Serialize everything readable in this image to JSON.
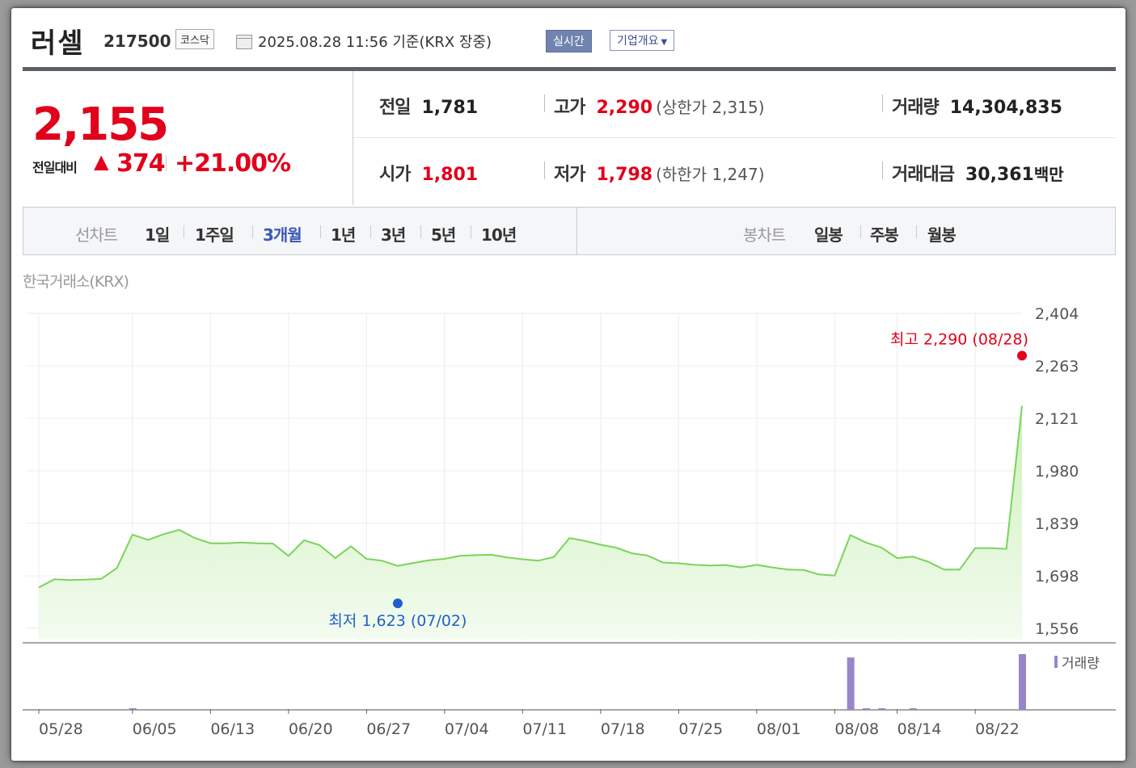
{
  "header": {
    "name": "러셀",
    "code": "217500",
    "market": "코스닥",
    "timestamp": "2025.08.28 11:56 기준(KRX 장중)",
    "realtime_label": "실시간",
    "company_label": "기업개요"
  },
  "price": {
    "current": "2,155",
    "change_label": "전일대비",
    "change_value": "374",
    "change_pct": "+21.00%"
  },
  "stats": {
    "prev_label": "전일",
    "prev": "1,781",
    "open_label": "시가",
    "open": "1,801",
    "high_label": "고가",
    "high": "2,290",
    "upper_label": "상한가",
    "upper": "2,315",
    "low_label": "저가",
    "low": "1,798",
    "lower_label": "하한가",
    "lower": "1,247",
    "volume_label": "거래량",
    "volume": "14,304,835",
    "amount_label": "거래대금",
    "amount": "30,361",
    "amount_unit": "백만"
  },
  "tabs": {
    "line_label": "선차트",
    "line_periods": [
      "1일",
      "1주일",
      "3개월",
      "1년",
      "3년",
      "5년",
      "10년"
    ],
    "active_period": "3개월",
    "candle_label": "봉차트",
    "candle_periods": [
      "일봉",
      "주봉",
      "월봉"
    ]
  },
  "exchange_label": "한국거래소(KRX)",
  "colors": {
    "up": "#e2001b",
    "down": "#1f5fc9",
    "line": "#79d45a",
    "volume": "#9b85c9",
    "active_tab": "#3b57b8"
  },
  "chart_data": {
    "type": "area",
    "ylim": [
      1556,
      2404
    ],
    "y_ticks": [
      "2,404",
      "2,263",
      "2,121",
      "1,980",
      "1,839",
      "1,698",
      "1,556"
    ],
    "x_tick_labels": [
      "05/28",
      "06/05",
      "06/13",
      "06/20",
      "06/27",
      "07/04",
      "07/11",
      "07/18",
      "07/25",
      "08/01",
      "08/08",
      "08/14",
      "08/22"
    ],
    "x_tick_index": [
      0,
      6,
      11,
      16,
      21,
      26,
      31,
      36,
      41,
      46,
      51,
      55,
      60
    ],
    "values": [
      1666,
      1688,
      1686,
      1687,
      1689,
      1718,
      1808,
      1794,
      1809,
      1821,
      1799,
      1785,
      1785,
      1787,
      1785,
      1784,
      1751,
      1793,
      1780,
      1745,
      1777,
      1743,
      1738,
      1724,
      1732,
      1739,
      1743,
      1751,
      1753,
      1754,
      1747,
      1742,
      1738,
      1748,
      1799,
      1791,
      1781,
      1773,
      1758,
      1752,
      1733,
      1731,
      1727,
      1725,
      1726,
      1720,
      1727,
      1720,
      1714,
      1713,
      1701,
      1698,
      1807,
      1787,
      1773,
      1745,
      1749,
      1735,
      1714,
      1714,
      1772,
      1772,
      1770,
      2155
    ],
    "high": {
      "label": "최고 2,290 (08/28)",
      "value": 2290,
      "index": 63
    },
    "low": {
      "label": "최저 1,623 (07/02)",
      "value": 1623,
      "index": 23
    },
    "volume_label": "거래량",
    "volume": [
      0,
      0,
      0,
      0,
      0,
      0,
      1,
      0,
      0,
      0,
      0,
      0,
      0,
      0,
      0,
      0,
      0,
      0,
      0,
      0,
      0,
      0,
      0,
      0,
      0,
      0,
      0,
      0,
      0,
      0,
      0,
      0,
      0,
      0,
      0,
      0,
      0,
      0,
      0,
      0,
      0,
      0,
      0,
      0,
      0,
      0,
      0,
      0,
      0,
      0,
      0,
      0,
      94,
      2,
      2,
      0,
      2,
      0,
      0,
      0,
      0,
      0,
      0,
      100
    ]
  }
}
